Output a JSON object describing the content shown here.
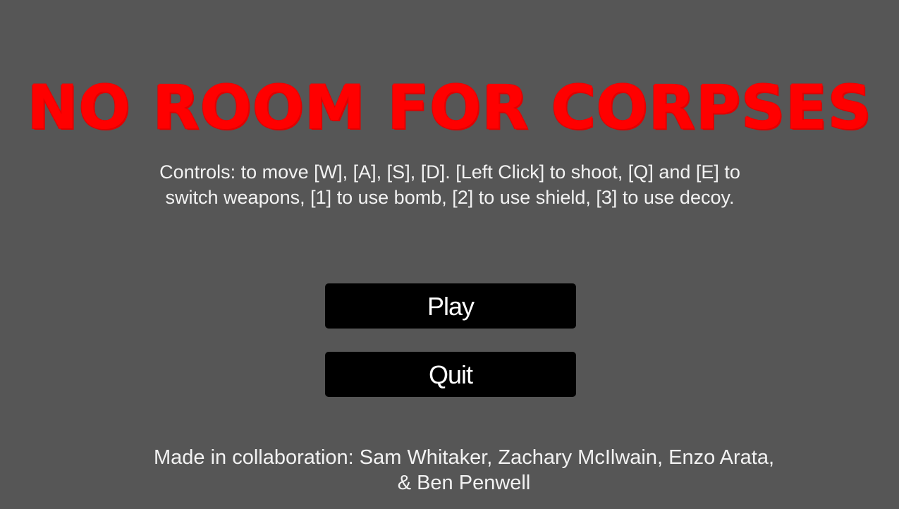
{
  "title": "NO ROOM FOR CORPSES",
  "controls_text": "Controls: to move [W], [A], [S], [D]. [Left Click] to shoot, [Q] and [E] to switch weapons, [1] to use bomb, [2] to use shield, [3] to use decoy.",
  "menu": {
    "play_label": "Play",
    "quit_label": "Quit"
  },
  "credits_text": "Made in collaboration: Sam Whitaker, Zachary McIlwain, Enzo Arata, & Ben Penwell",
  "colors": {
    "background": "#565656",
    "title": "#ff0000",
    "button": "#000000",
    "text": "#f2f2f2"
  }
}
